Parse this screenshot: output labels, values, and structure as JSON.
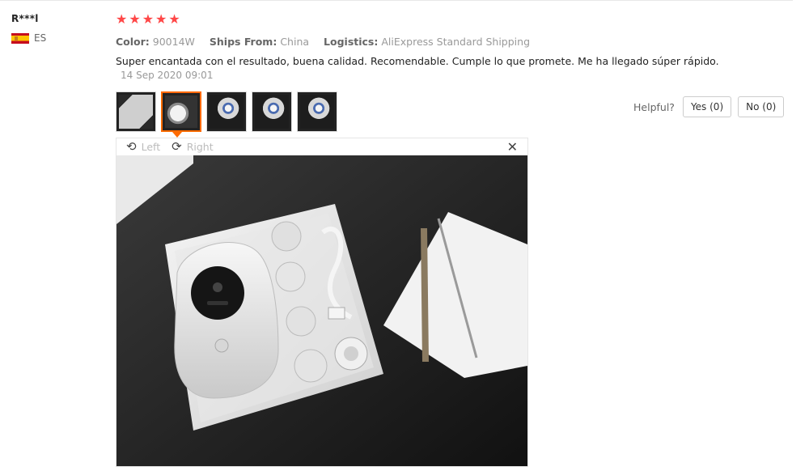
{
  "reviewer": {
    "name": "R***l",
    "country": "ES",
    "flag_icon": "spain-flag-icon"
  },
  "rating": {
    "value": 5,
    "max": 5,
    "color": "#ff4747"
  },
  "meta": {
    "color_label": "Color:",
    "color_value": "90014W",
    "ships_label": "Ships From:",
    "ships_value": "China",
    "logistics_label": "Logistics:",
    "logistics_value": "AliExpress Standard Shipping"
  },
  "review": {
    "text": "Super encantada con el resultado, buena calidad. Recomendable. Cumple lo que promete. Me ha llegado súper rápido.",
    "date": "14 Sep 2020 09:01"
  },
  "thumbnails": {
    "count": 5,
    "active_index": 1,
    "active_color": "#ff6a00"
  },
  "helpful": {
    "label": "Helpful?",
    "yes": "Yes (0)",
    "no": "No (0)"
  },
  "viewer": {
    "rotate_left": "Left",
    "rotate_right": "Right",
    "rotate_left_icon": "rotate-left-icon",
    "rotate_right_icon": "rotate-right-icon",
    "close_icon": "close-icon"
  }
}
